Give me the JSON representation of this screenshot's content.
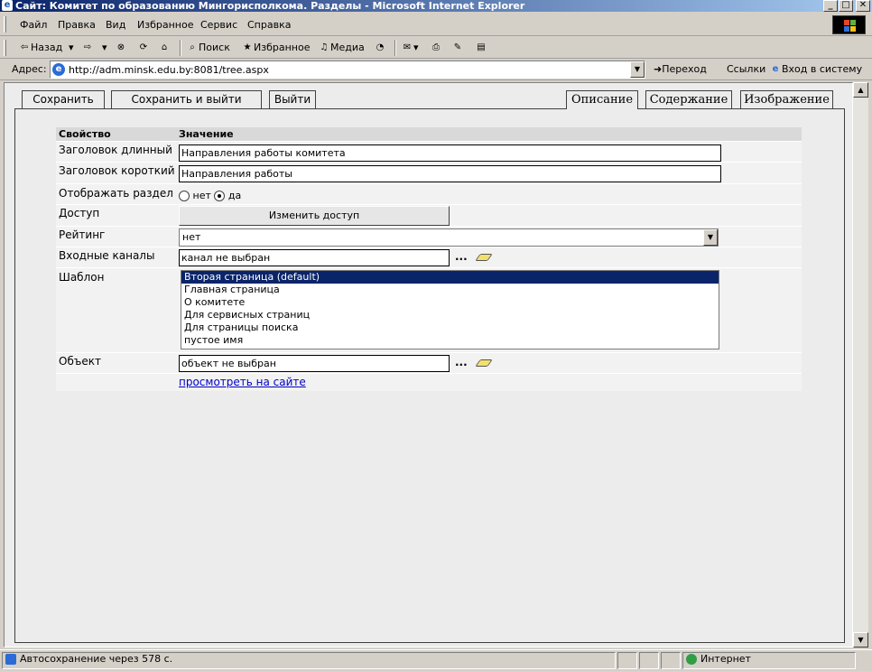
{
  "window": {
    "title": "Сайт: Комитет по образованию Мингорисполкома. Разделы - Microsoft Internet Explorer",
    "minimize": "_",
    "maximize": "□",
    "close": "✕"
  },
  "menu": {
    "items": [
      "Файл",
      "Правка",
      "Вид",
      "Избранное",
      "Сервис",
      "Справка"
    ]
  },
  "toolbar": {
    "back": "Назад",
    "search": "Поиск",
    "favorites": "Избранное",
    "media": "Медиа"
  },
  "address": {
    "label": "Адрес:",
    "url": "http://adm.minsk.edu.by:8081/tree.aspx",
    "go": "Переход",
    "links": "Ссылки",
    "login": "Вход в систему"
  },
  "actions": {
    "save": "Сохранить",
    "save_exit": "Сохранить и выйти",
    "exit": "Выйти"
  },
  "tabs": {
    "description": "Описание",
    "content": "Содержание",
    "image": "Изображение"
  },
  "table": {
    "header_property": "Свойство",
    "header_value": "Значение",
    "long_title_label": "Заголовок длинный",
    "long_title_value": "Направления работы комитета",
    "short_title_label": "Заголовок короткий",
    "short_title_value": "Направления работы",
    "show_section_label": "Отображать раздел",
    "radio_no": "нет",
    "radio_yes": "да",
    "access_label": "Доступ",
    "access_button": "Изменить доступ",
    "rating_label": "Рейтинг",
    "rating_value": "нет",
    "channels_label": "Входные каналы",
    "channels_value": "канал не выбран",
    "template_label": "Шаблон",
    "template_options": [
      "Вторая страница (default)",
      "Главная страница",
      "О комитете",
      "Для сервисных страниц",
      "Для страницы поиска",
      "пустое имя"
    ],
    "object_label": "Объект",
    "object_value": "объект не выбран",
    "ellipsis": "...",
    "view_link": "просмотреть на сайте"
  },
  "status": {
    "text": "Автосохранение через 578 с.",
    "zone": "Интернет"
  }
}
